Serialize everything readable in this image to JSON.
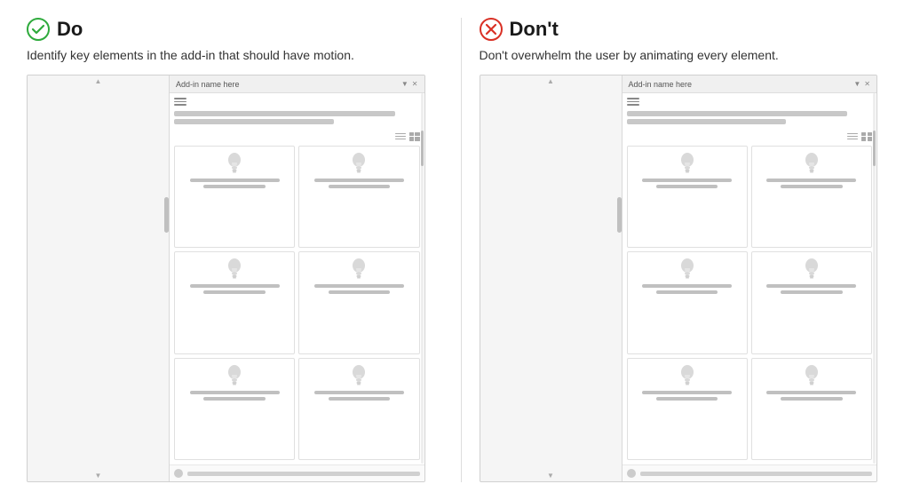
{
  "do": {
    "icon_label": "✓",
    "title": "Do",
    "description": "Identify key elements in the add-in that should have motion.",
    "addin_name": "Add-in name here",
    "collapse_icon": "▼",
    "close_icon": "✕"
  },
  "dont": {
    "icon_label": "✕",
    "title": "Don't",
    "description": "Don't overwhelm the user by animating every element.",
    "addin_name": "Add-in name here",
    "collapse_icon": "▼",
    "close_icon": "✕"
  },
  "cards": [
    {
      "id": 1
    },
    {
      "id": 2
    },
    {
      "id": 3
    },
    {
      "id": 4
    },
    {
      "id": 5
    },
    {
      "id": 6
    }
  ]
}
